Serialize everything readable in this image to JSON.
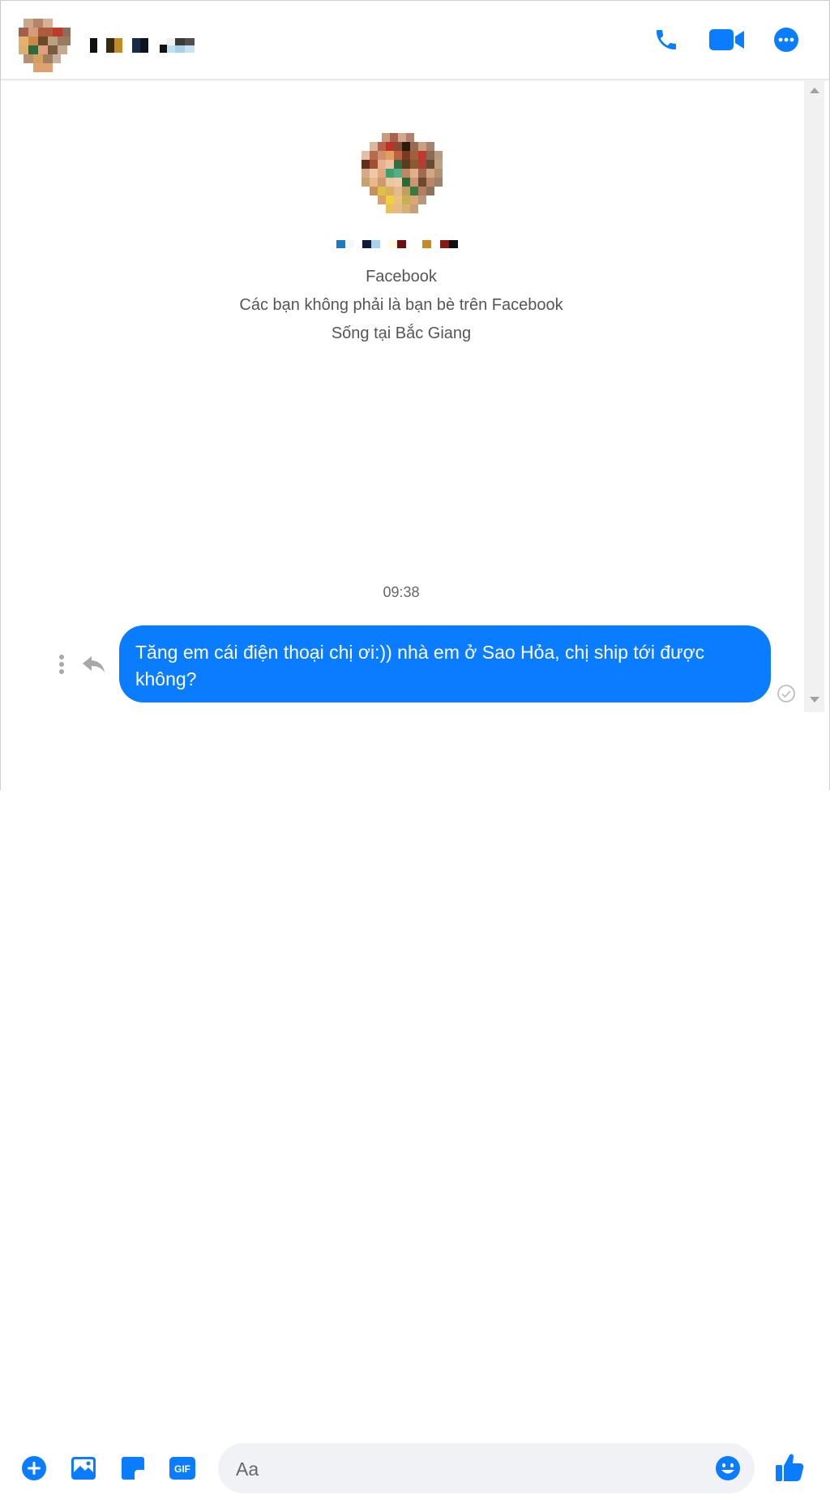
{
  "header": {
    "contact_name_hidden": true,
    "actions": [
      {
        "name": "phone-call",
        "icon": "phone-icon"
      },
      {
        "name": "video-call",
        "icon": "video-camera-icon"
      },
      {
        "name": "more-options",
        "icon": "more-icon"
      }
    ]
  },
  "intro": {
    "line1": "Facebook",
    "line2": "Các bạn không phải là bạn bè trên Facebook",
    "line3": "Sống tại Bắc Giang"
  },
  "thread": {
    "timestamp": "09:38",
    "messages": [
      {
        "from": "me",
        "text": "Tăng em cái điện thoại chị ơi:)) nhà em ở Sao Hỏa, chị ship tới được không?"
      }
    ]
  },
  "composer": {
    "placeholder": "Aa",
    "value": "",
    "buttons": [
      {
        "name": "more-actions",
        "icon": "plus-circle-icon"
      },
      {
        "name": "attach-image",
        "icon": "image-icon"
      },
      {
        "name": "sticker",
        "icon": "sticker-icon"
      },
      {
        "name": "gif",
        "icon": "gif-icon",
        "label": "GIF"
      }
    ],
    "send_icon": "thumbs-up-icon"
  },
  "colors": {
    "accent": "#0a7cff",
    "bubble_text": "#ffffff",
    "secondary_text": "#555555"
  }
}
